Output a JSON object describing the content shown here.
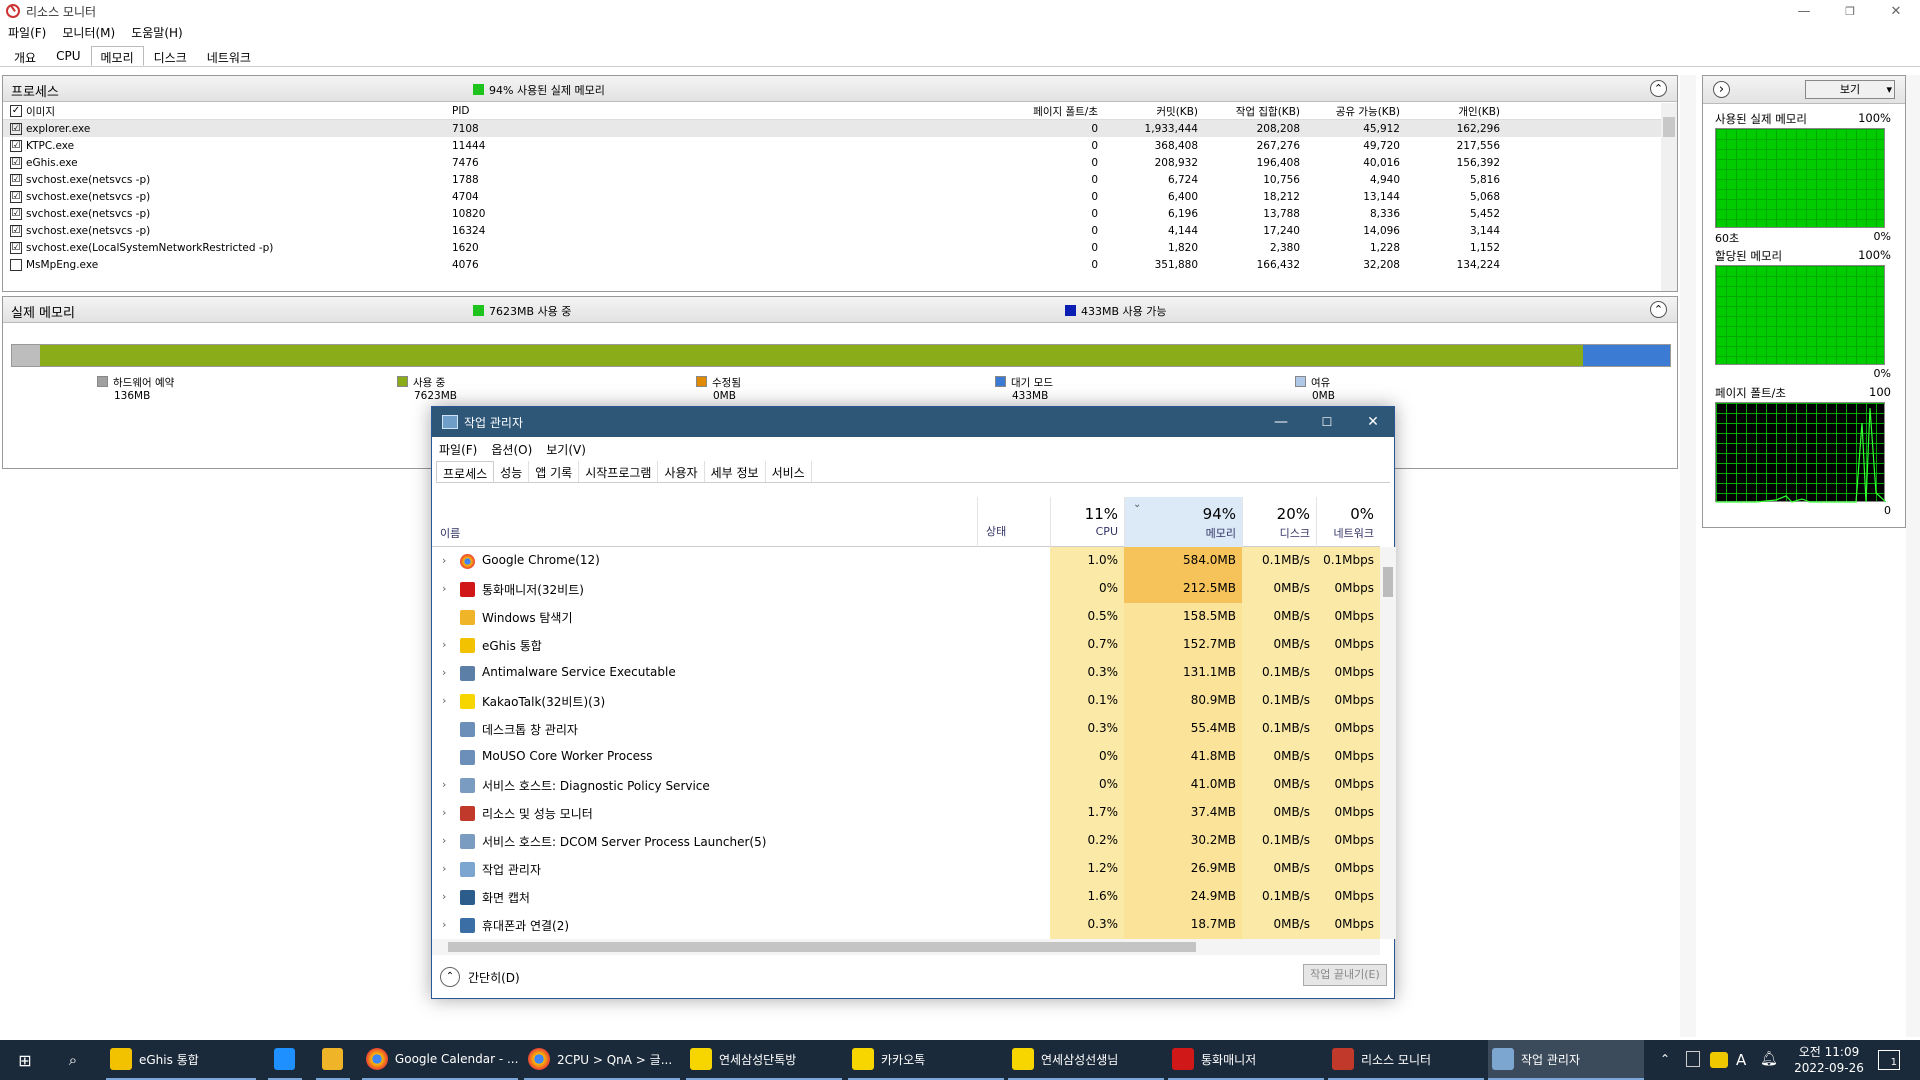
{
  "rm": {
    "title": "리소스 모니터",
    "menu": [
      "파일(F)",
      "모니터(M)",
      "도움말(H)"
    ],
    "tabs": [
      "개요",
      "CPU",
      "메모리",
      "디스크",
      "네트워크"
    ],
    "active_tab": "메모리",
    "window_controls": {
      "minimize": "—",
      "restore": "❐",
      "close": "✕"
    },
    "process_panel": {
      "title": "프로세스",
      "status": "94% 사용된 실제 메모리",
      "columns": {
        "image": "이미지",
        "pid": "PID",
        "hard_faults": "페이지 폴트/초",
        "commit": "커밋(KB)",
        "working_set": "작업 집합(KB)",
        "shareable": "공유 가능(KB)",
        "private": "개인(KB)"
      },
      "rows": [
        {
          "image": "explorer.exe",
          "pid": "7108",
          "hf": "0",
          "commit": "1,933,444",
          "ws": "208,208",
          "share": "45,912",
          "priv": "162,296",
          "checked": "☑"
        },
        {
          "image": "KTPC.exe",
          "pid": "11444",
          "hf": "0",
          "commit": "368,408",
          "ws": "267,276",
          "share": "49,720",
          "priv": "217,556",
          "checked": "☑"
        },
        {
          "image": "eGhis.exe",
          "pid": "7476",
          "hf": "0",
          "commit": "208,932",
          "ws": "196,408",
          "share": "40,016",
          "priv": "156,392",
          "checked": "☑"
        },
        {
          "image": "svchost.exe(netsvcs -p)",
          "pid": "1788",
          "hf": "0",
          "commit": "6,724",
          "ws": "10,756",
          "share": "4,940",
          "priv": "5,816",
          "checked": "☑"
        },
        {
          "image": "svchost.exe(netsvcs -p)",
          "pid": "4704",
          "hf": "0",
          "commit": "6,400",
          "ws": "18,212",
          "share": "13,144",
          "priv": "5,068",
          "checked": "☑"
        },
        {
          "image": "svchost.exe(netsvcs -p)",
          "pid": "10820",
          "hf": "0",
          "commit": "6,196",
          "ws": "13,788",
          "share": "8,336",
          "priv": "5,452",
          "checked": "☑"
        },
        {
          "image": "svchost.exe(netsvcs -p)",
          "pid": "16324",
          "hf": "0",
          "commit": "4,144",
          "ws": "17,240",
          "share": "14,096",
          "priv": "3,144",
          "checked": "☑"
        },
        {
          "image": "svchost.exe(LocalSystemNetworkRestricted -p)",
          "pid": "1620",
          "hf": "0",
          "commit": "1,820",
          "ws": "2,380",
          "share": "1,228",
          "priv": "1,152",
          "checked": "☑"
        },
        {
          "image": "MsMpEng.exe",
          "pid": "4076",
          "hf": "0",
          "commit": "351,880",
          "ws": "166,432",
          "share": "32,208",
          "priv": "134,224",
          "checked": ""
        }
      ]
    },
    "memory_panel": {
      "title": "실제 메모리",
      "in_use": "7623MB 사용 중",
      "available": "433MB 사용 가능",
      "bar": {
        "hardware_fraction": 0.017,
        "in_use_fraction": 0.935,
        "standby_fraction": 0.053
      },
      "legend": [
        {
          "label": "하드웨어 예약",
          "value": "136MB",
          "color": "#a0a0a0"
        },
        {
          "label": "사용 중",
          "value": "7623MB",
          "color": "#8aac18"
        },
        {
          "label": "수정됨",
          "value": "0MB",
          "color": "#e08a00"
        },
        {
          "label": "대기 모드",
          "value": "433MB",
          "color": "#3c7bd3"
        },
        {
          "label": "여유",
          "value": "0MB",
          "color": "#b0c8e8"
        }
      ]
    },
    "side": {
      "view_label": "보기",
      "graphs": [
        {
          "title": "사용된 실제 메모리",
          "max": "100%",
          "left_footer": "60초",
          "right_footer": "0%"
        },
        {
          "title": "할당된 메모리",
          "max": "100%",
          "left_footer": "",
          "right_footer": "0%"
        },
        {
          "title": "페이지 폴트/초",
          "max": "100",
          "left_footer": "",
          "right_footer": "0"
        }
      ]
    }
  },
  "tm": {
    "title": "작업 관리자",
    "menu": [
      "파일(F)",
      "옵션(O)",
      "보기(V)"
    ],
    "tabs": [
      "프로세스",
      "성능",
      "앱 기록",
      "시작프로그램",
      "사용자",
      "세부 정보",
      "서비스"
    ],
    "active_tab": "프로세스",
    "header": {
      "name": "이름",
      "status": "상태",
      "cpu": {
        "pct": "11%",
        "label": "CPU"
      },
      "mem": {
        "pct": "94%",
        "label": "메모리"
      },
      "disk": {
        "pct": "20%",
        "label": "디스크"
      },
      "net": {
        "pct": "0%",
        "label": "네트워크"
      }
    },
    "rows": [
      {
        "name": "Google Chrome(12)",
        "exp": "›",
        "cpu": "1.0%",
        "mem": "584.0MB",
        "disk": "0.1MB/s",
        "net": "0.1Mbps",
        "icon": "chrome-icon"
      },
      {
        "name": "통화매니저(32비트)",
        "exp": "›",
        "cpu": "0%",
        "mem": "212.5MB",
        "disk": "0MB/s",
        "net": "0Mbps",
        "icon": "callmanager-icon"
      },
      {
        "name": "Windows 탐색기",
        "exp": "",
        "cpu": "0.5%",
        "mem": "158.5MB",
        "disk": "0MB/s",
        "net": "0Mbps",
        "icon": "folder-icon"
      },
      {
        "name": "eGhis 통합",
        "exp": "›",
        "cpu": "0.7%",
        "mem": "152.7MB",
        "disk": "0MB/s",
        "net": "0Mbps",
        "icon": "eghis-icon"
      },
      {
        "name": "Antimalware Service Executable",
        "exp": "›",
        "cpu": "0.3%",
        "mem": "131.1MB",
        "disk": "0.1MB/s",
        "net": "0Mbps",
        "icon": "service-icon"
      },
      {
        "name": "KakaoTalk(32비트)(3)",
        "exp": "›",
        "cpu": "0.1%",
        "mem": "80.9MB",
        "disk": "0.1MB/s",
        "net": "0Mbps",
        "icon": "kakao-icon"
      },
      {
        "name": "데스크톱 창 관리자",
        "exp": "",
        "cpu": "0.3%",
        "mem": "55.4MB",
        "disk": "0.1MB/s",
        "net": "0Mbps",
        "icon": "window-icon"
      },
      {
        "name": "MoUSO Core Worker Process",
        "exp": "",
        "cpu": "0%",
        "mem": "41.8MB",
        "disk": "0MB/s",
        "net": "0Mbps",
        "icon": "window-icon"
      },
      {
        "name": "서비스 호스트: Diagnostic Policy Service",
        "exp": "›",
        "cpu": "0%",
        "mem": "41.0MB",
        "disk": "0MB/s",
        "net": "0Mbps",
        "icon": "gear-icon"
      },
      {
        "name": "리소스 및 성능 모니터",
        "exp": "›",
        "cpu": "1.7%",
        "mem": "37.4MB",
        "disk": "0MB/s",
        "net": "0Mbps",
        "icon": "monitor-icon"
      },
      {
        "name": "서비스 호스트: DCOM Server Process Launcher(5)",
        "exp": "›",
        "cpu": "0.2%",
        "mem": "30.2MB",
        "disk": "0.1MB/s",
        "net": "0Mbps",
        "icon": "gear-icon"
      },
      {
        "name": "작업 관리자",
        "exp": "›",
        "cpu": "1.2%",
        "mem": "26.9MB",
        "disk": "0MB/s",
        "net": "0Mbps",
        "icon": "taskmgr-icon"
      },
      {
        "name": "화면 캡처",
        "exp": "›",
        "cpu": "1.6%",
        "mem": "24.9MB",
        "disk": "0.1MB/s",
        "net": "0Mbps",
        "icon": "capture-icon"
      },
      {
        "name": "휴대폰과 연결(2)",
        "exp": "›",
        "cpu": "0.3%",
        "mem": "18.7MB",
        "disk": "0MB/s",
        "net": "0Mbps",
        "icon": "phone-icon"
      }
    ],
    "footer": {
      "fewer": "간단히(D)",
      "end_task": "작업 끝내기(E)"
    }
  },
  "taskbar": {
    "items": [
      {
        "label": "eGhis 통합",
        "icon": "eghis-icon"
      },
      {
        "label": "",
        "icon": "desktop-icon"
      },
      {
        "label": "",
        "icon": "explorer-icon"
      },
      {
        "label": "Google Calendar - ...",
        "icon": "chrome-icon"
      },
      {
        "label": "2CPU > QnA > 글...",
        "icon": "chrome-icon"
      },
      {
        "label": "연세삼성단톡방",
        "icon": "kakao-icon"
      },
      {
        "label": "카카오톡",
        "icon": "kakao-icon"
      },
      {
        "label": "연세삼성선생님",
        "icon": "kakao-icon"
      },
      {
        "label": "통화매니저",
        "icon": "callmanager-icon"
      },
      {
        "label": "리소스 모니터",
        "icon": "monitor-icon"
      },
      {
        "label": "작업 관리자",
        "icon": "taskmgr-icon"
      }
    ],
    "tray": {
      "ime": "A",
      "time": "오전 11:09",
      "date": "2022-09-26",
      "notif": "1"
    }
  }
}
